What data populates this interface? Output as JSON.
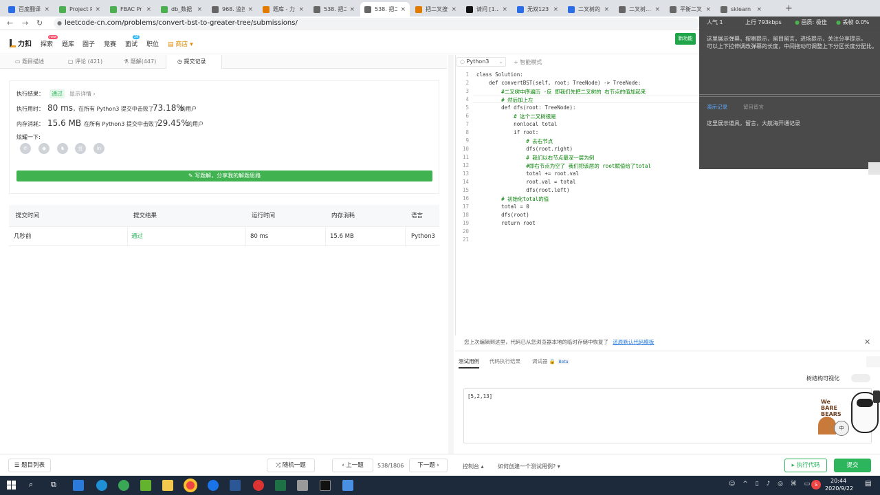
{
  "browser": {
    "tabs": [
      {
        "label": "百度翻译",
        "color": "#2b6de5"
      },
      {
        "label": "Project R",
        "color": "#4caf50"
      },
      {
        "label": "FBAC Pr",
        "color": "#4caf50"
      },
      {
        "label": "db_数据",
        "color": "#4caf50"
      },
      {
        "label": "968. 监控",
        "color": "#666"
      },
      {
        "label": "题库 - 力",
        "color": "#e07b00"
      },
      {
        "label": "538. 把二",
        "color": "#666"
      },
      {
        "label": "538. 把二",
        "color": "#666"
      },
      {
        "label": "把二叉搜",
        "color": "#e07b00"
      },
      {
        "label": "请问 [1...",
        "color": "#111"
      },
      {
        "label": "无双123",
        "color": "#2b6de5"
      },
      {
        "label": "二叉树的",
        "color": "#2b6de5"
      },
      {
        "label": "二叉树...",
        "color": "#666"
      },
      {
        "label": "平衡二叉",
        "color": "#666"
      },
      {
        "label": "sklearn",
        "color": "#666"
      }
    ],
    "url": "leetcode-cn.com/problems/convert-bst-to-greater-tree/submissions/"
  },
  "site": {
    "logo": "力扣",
    "nav": [
      "探索",
      "题库",
      "圈子",
      "竞赛",
      "面试",
      "职位"
    ],
    "badge_new": "new",
    "badge_count": "28",
    "store": "商店",
    "new_feature": "新功能"
  },
  "left_tabs": [
    "题目描述",
    "评论 (421)",
    "题解(447)",
    "提交记录"
  ],
  "result": {
    "status_label": "执行结果：",
    "status_value": "通过",
    "show_detail": "显示详情 ›",
    "time_label": "执行用时：",
    "time_value": "80 ms",
    "time_mid": "，在所有 Python3 提交中击败了",
    "time_pct": "73.18%",
    "time_suffix": "的用户",
    "mem_label": "内存消耗：",
    "mem_value": "15.6 MB",
    "mem_mid": "，在所有 Python3 提交中击败了",
    "mem_pct": "29.45%",
    "mem_suffix": "的用户",
    "share_label": "炫耀一下:",
    "share_button": "写题解，分享我的解题思路",
    "share_icons": [
      "wechat-icon",
      "weibo-icon",
      "qq-icon",
      "douban-icon",
      "linkedin-icon"
    ]
  },
  "submissions": {
    "headers": [
      "提交时间",
      "提交结果",
      "运行时间",
      "内存消耗",
      "语言"
    ],
    "rows": [
      [
        "几秒前",
        "通过",
        "80 ms",
        "15.6 MB",
        "Python3"
      ]
    ]
  },
  "editor": {
    "language": "Python3",
    "mode": "智能模式",
    "lines": [
      "class Solution:",
      "    def convertBST(self, root: TreeNode) -> TreeNode:",
      "        #二叉树中序遍历 -反 即我们先把二叉树的 右节点的值加起来",
      "        # 然后加上左",
      "        def dfs(root: TreeNode):",
      "            # 这个二叉树很是",
      "            nonlocal total",
      "            if root:",
      "                # 去右节点",
      "                dfs(root.right)",
      "                # 我们以右节点最深一层为例",
      "                #即右节点为空了 我们把该层的 root赋值给了total",
      "                total += root.val",
      "                root.val = total",
      "                dfs(root.left)",
      "        # 初始化total的值",
      "        total = 0",
      "        dfs(root)",
      "        return root",
      "",
      ""
    ]
  },
  "notice": {
    "text": "您上次编辑到这里，代码已从您浏览器本地的临时存储中恢复了",
    "link": "还原默认代码模板"
  },
  "test_panel": {
    "tabs": [
      "测试用例",
      "代码执行结果",
      "调试器"
    ],
    "beta": "Beta",
    "visualize": "树结构可视化",
    "input": "[5,2,13]"
  },
  "bottom": {
    "question_list": "题目列表",
    "random": "随机一题",
    "prev": "上一题",
    "progress": "538/1806",
    "next": "下一题",
    "console": "控制台",
    "how_to": "如何创建一个测试用例?",
    "run": "执行代码",
    "submit": "提交"
  },
  "overlay": {
    "popularity": "人气 1",
    "upload": "上行 793kbps",
    "quality": "画质: 极佳",
    "loss": "丢帧 0.0%",
    "tips": "这里展示弹幕，按喇提示，留目留言，进场提示，关注分享提示。",
    "tips2": "可以上下拉伸调改弹幕的长度，中间拖动可调整上下分区长度分配比。",
    "tab1": "演示记录",
    "tab2": "留目留言",
    "footer": "这里展示道具，留言，大航海开通记录"
  },
  "taskbar": {
    "time": "20:44",
    "date": "2020/9/22"
  }
}
